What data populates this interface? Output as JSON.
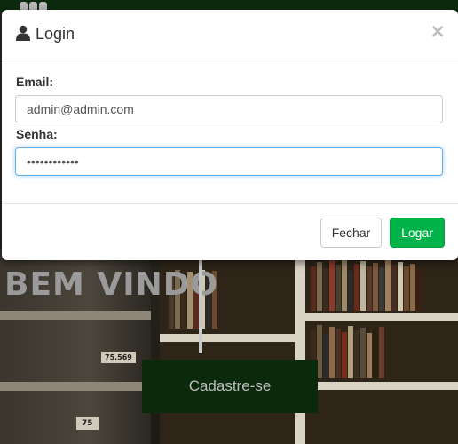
{
  "modal": {
    "title": "Login",
    "close_symbol": "×",
    "icon": "user-icon",
    "email_label": "Email:",
    "email_value": "admin@admin.com",
    "password_label": "Senha:",
    "password_value": "adminadmin12",
    "cancel_label": "Fechar",
    "submit_label": "Logar"
  },
  "background": {
    "welcome_text": "BEM VINDO",
    "register_label": "Cadastre-se",
    "book_label_1": "75.569",
    "book_label_2": "75"
  },
  "colors": {
    "primary_button": "#00b24a",
    "focus_border": "#66afe9",
    "register_button": "#0b2a0c",
    "top_bar": "#0c2a0e"
  }
}
